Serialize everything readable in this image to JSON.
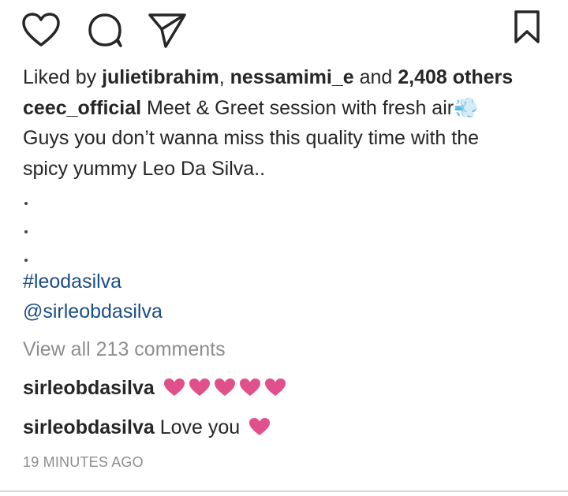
{
  "actions": {
    "like_icon": "heart-outline-icon",
    "comment_icon": "comment-bubble-icon",
    "share_icon": "paper-plane-icon",
    "save_icon": "bookmark-icon"
  },
  "likes": {
    "prefix": "Liked by ",
    "user1": "julietibrahim",
    "separator": ", ",
    "user2": "nessamimi_e",
    "and": " and ",
    "others": "2,408 others"
  },
  "caption": {
    "username": "ceec_official",
    "line1": " Meet & Greet session with fresh air💨",
    "line2": "Guys you don’t wanna miss this quality time with the",
    "line3": "spicy yummy Leo Da Silva..",
    "hashtag": "#leodasilva",
    "mention": "@sirleobdasilva"
  },
  "view_comments": "View all 213 comments",
  "comments": [
    {
      "username": "sirleobdasilva",
      "text": "",
      "hearts": 5
    },
    {
      "username": "sirleobdasilva",
      "text": " Love you",
      "hearts": 1
    }
  ],
  "timestamp": "19 MINUTES AGO",
  "colors": {
    "heart_emoji": "#e0508a",
    "link": "#1b4d86",
    "muted": "#8e8e8e",
    "text": "#262626"
  }
}
